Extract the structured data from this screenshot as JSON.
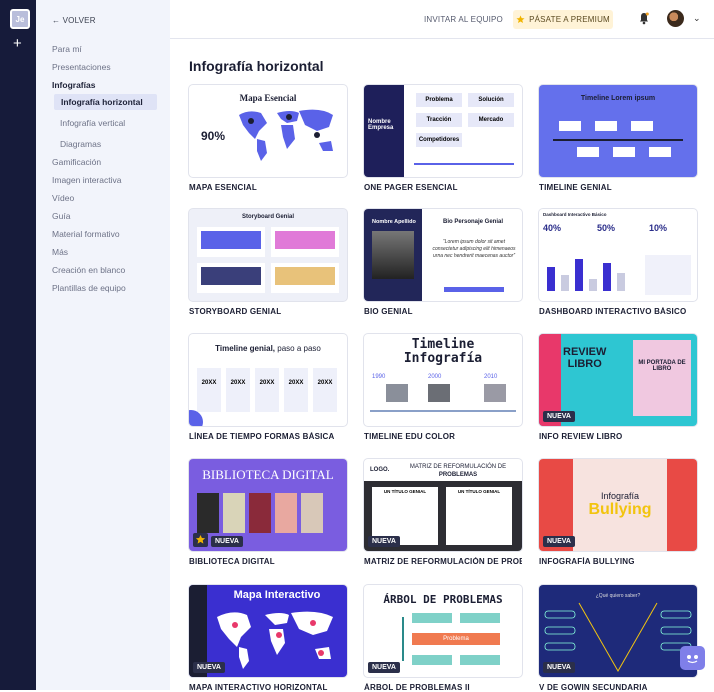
{
  "rail": {
    "avatar_initials": "Je",
    "add_label": "+"
  },
  "sidebar": {
    "back_label": "← VOLVER",
    "items": [
      {
        "label": "Para mí"
      },
      {
        "label": "Presentaciones"
      },
      {
        "label": "Infografías"
      },
      {
        "label": "Infografía horizontal"
      },
      {
        "label": "Infografía vertical"
      },
      {
        "label": "Diagramas"
      },
      {
        "label": "Gamificación"
      },
      {
        "label": "Imagen interactiva"
      },
      {
        "label": "Vídeo"
      },
      {
        "label": "Guía"
      },
      {
        "label": "Material formativo"
      },
      {
        "label": "Más"
      },
      {
        "label": "Creación en blanco"
      },
      {
        "label": "Plantillas de equipo"
      }
    ]
  },
  "header": {
    "invite_label": "INVITAR AL EQUIPO",
    "premium_label": "PÁSATE A PREMIUM"
  },
  "page_title": "Infografía horizontal",
  "badge_new": "NUEVA",
  "cards": [
    {
      "title": "MAPA ESENCIAL",
      "thumb": {
        "heading": "Mapa Esencial",
        "stat": "90%"
      }
    },
    {
      "title": "ONE PAGER ESENCIAL",
      "thumb": {
        "heading": "Nombre Empresa",
        "cells": [
          "Problema",
          "Solución",
          "Tracción",
          "Mercado",
          "Competidores"
        ]
      }
    },
    {
      "title": "TIMELINE GENIAL",
      "thumb": {
        "heading": "Timeline Lorem ipsum"
      }
    },
    {
      "title": "STORYBOARD GENIAL",
      "thumb": {
        "heading": "Storyboard Genial"
      }
    },
    {
      "title": "BIO GENIAL",
      "thumb": {
        "heading": "Bio Personaje Genial",
        "name": "Nombre Apellido",
        "quote": "“Lorem ipsum dolor sit amet consectetur adipiscing elit himenaeos urna nec hendrerit maecenas auctor”"
      }
    },
    {
      "title": "DASHBOARD INTERACTIVO BÁSICO",
      "thumb": {
        "heading": "Dashboard Interactivo Básico",
        "stats": [
          "40%",
          "50%",
          "10%"
        ]
      }
    },
    {
      "title": "LÍNEA DE TIEMPO FORMAS BÁSICA",
      "thumb": {
        "heading": "Timeline genial,",
        "heading2": "paso a paso",
        "years": [
          "20XX",
          "20XX",
          "20XX",
          "20XX",
          "20XX"
        ]
      }
    },
    {
      "title": "TIMELINE EDU COLOR",
      "thumb": {
        "heading": "Timeline",
        "heading2": "Infografía",
        "years": [
          "1990",
          "2000",
          "2010"
        ]
      }
    },
    {
      "title": "INFO REVIEW LIBRO",
      "thumb": {
        "heading": "REVIEW",
        "heading2": "LIBRO",
        "sub": "MI PORTADA DE LIBRO"
      },
      "is_new": true
    },
    {
      "title": "BIBLIOTECA DIGITAL",
      "thumb": {
        "heading": "BIBLIOTECA DIGITAL"
      },
      "is_new": true,
      "starred": true
    },
    {
      "title": "MATRIZ DE REFORMULACIÓN DE PROB...",
      "thumb": {
        "logo": "LOGO.",
        "heading": "MATRIZ DE REFORMULACIÓN DE",
        "heading2": "PROBLEMAS",
        "col": "UN TÍTULO GENIAL"
      },
      "is_new": true
    },
    {
      "title": "INFOGRAFÍA BULLYING",
      "thumb": {
        "heading": "Infografía",
        "heading2": "Bullying"
      },
      "is_new": true
    },
    {
      "title": "MAPA INTERACTIVO HORIZONTAL",
      "thumb": {
        "heading": "Mapa Interactivo"
      },
      "is_new": true
    },
    {
      "title": "ÁRBOL DE PROBLEMAS II",
      "thumb": {
        "heading": "ÁRBOL DE PROBLEMAS",
        "box": "Problema"
      },
      "is_new": true
    },
    {
      "title": "V DE GOWIN SECUNDARIA",
      "thumb": {
        "heading": "¿Qué quiero saber?"
      },
      "is_new": true
    }
  ],
  "colors": {
    "rail": "#161b3a",
    "sidebar": "#f2f4fb",
    "accent": "#5b5bd6",
    "premium_bg": "#fff3d7"
  }
}
